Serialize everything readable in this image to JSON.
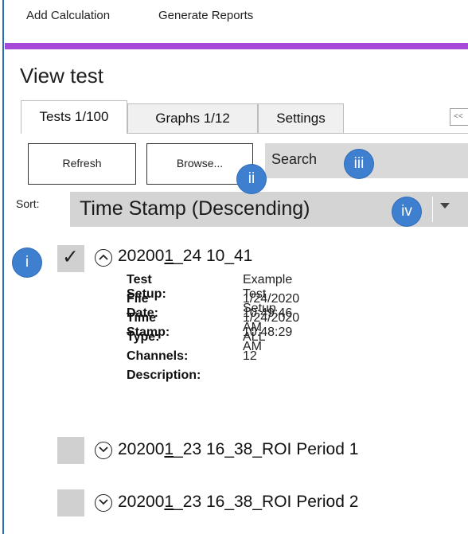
{
  "menu": {
    "add_calculation": "Add Calculation",
    "generate_reports": "Generate Reports"
  },
  "colors": {
    "accent": "#a64ad9",
    "callout": "#3e7fcf",
    "frame": "#2a6fb0"
  },
  "view": {
    "title": "View test"
  },
  "tabs": [
    {
      "label": "Tests 1/100",
      "active": true
    },
    {
      "label": "Graphs 1/12",
      "active": false
    },
    {
      "label": "Settings",
      "active": false
    }
  ],
  "tab_collapse": {
    "label": "<<"
  },
  "toolbar": {
    "refresh_label": "Refresh",
    "browse_label": "Browse...",
    "search_placeholder": "Search"
  },
  "sort": {
    "label": "Sort:",
    "value": "Time Stamp (Descending)",
    "arrow_icon": "chevron-down-icon"
  },
  "callouts": {
    "i": "i",
    "ii": "ii",
    "iii": "iii",
    "iv": "iv"
  },
  "tests": [
    {
      "checked": true,
      "expanded": true,
      "name_pre": "20200",
      "name_u": "1",
      "name_post": "_24 10_41",
      "details": [
        {
          "label": "Test Setup:",
          "value": "Example Test Setup"
        },
        {
          "label": "File Date:",
          "value": "1/24/2020 10:49:46 AM"
        },
        {
          "label": "Time Stamp:",
          "value": "1/24/2020 10:48:29 AM"
        },
        {
          "label": "Type:",
          "value": "ALL"
        },
        {
          "label": "Channels:",
          "value": "12"
        },
        {
          "label": "Description:",
          "value": ""
        }
      ]
    },
    {
      "checked": false,
      "expanded": false,
      "name_pre": "20200",
      "name_u": "1",
      "name_post": "_23 16_38_ROI Period 1"
    },
    {
      "checked": false,
      "expanded": false,
      "name_pre": "20200",
      "name_u": "1",
      "name_post": "_23 16_38_ROI Period 2"
    }
  ]
}
